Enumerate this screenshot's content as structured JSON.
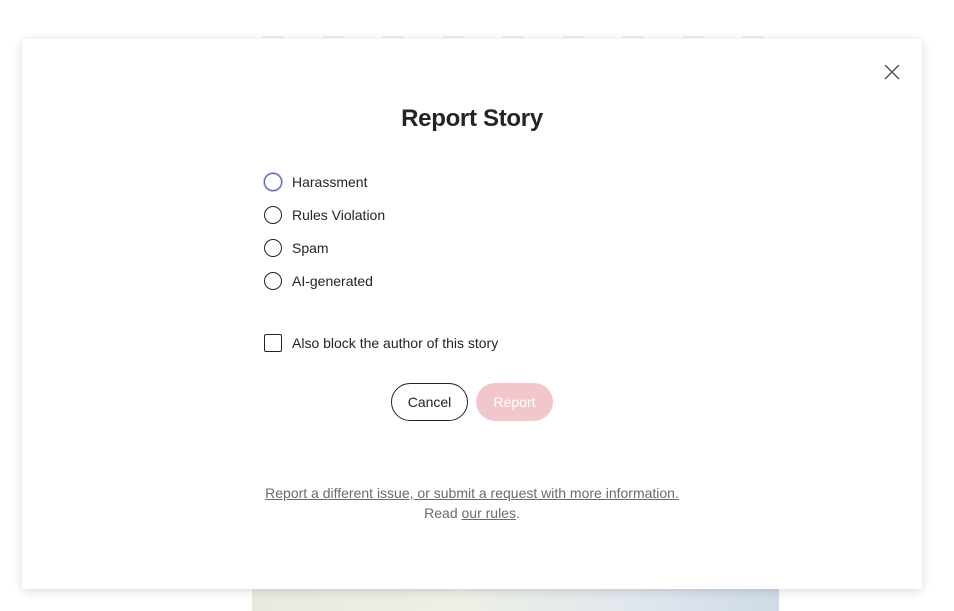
{
  "modal": {
    "title": "Report Story",
    "options": [
      {
        "label": "Harassment"
      },
      {
        "label": "Rules Violation"
      },
      {
        "label": "Spam"
      },
      {
        "label": "AI-generated"
      }
    ],
    "block_author_label": "Also block the author of this story",
    "cancel_label": "Cancel",
    "report_label": "Report",
    "footer": {
      "link_text": "Report a different issue, or submit a request with more information.",
      "read_prefix": "Read ",
      "rules_link": "our rules",
      "read_suffix": "."
    }
  },
  "colors": {
    "text": "#242424",
    "muted": "#6b6b6b",
    "report_disabled_bg": "#f2c7cc",
    "focus_ring": "#4a5aa8"
  },
  "icons": {
    "close": "close-icon"
  }
}
